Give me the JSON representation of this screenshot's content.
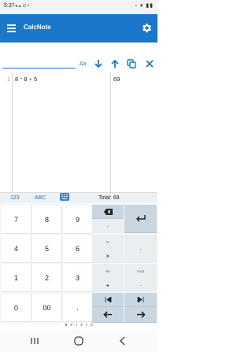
{
  "status_bar": {
    "time": "5:37"
  },
  "app": {
    "title": "CalcNote"
  },
  "find": {
    "placeholder": "",
    "value": "",
    "match_case_label": "Aa"
  },
  "editor": {
    "line_number": "1",
    "expression": {
      "a": "8",
      "op1": "*",
      "b": "8",
      "op2": "+",
      "c": "5"
    },
    "result": "69"
  },
  "keyboard": {
    "tabs": {
      "numeric": "123",
      "alpha": "ABC"
    },
    "total_label": "Total:",
    "total_value": "69",
    "digits": [
      "7",
      "8",
      "9",
      "4",
      "5",
      "6",
      "1",
      "2",
      "3",
      "0",
      "00",
      "."
    ],
    "ops": [
      {
        "main": "",
        "sub": "/"
      },
      {
        "main": "",
        "sub": "%"
      },
      {
        "main": "×",
        "sub": "÷"
      },
      {
        "main": "",
        "sub": "mod"
      },
      {
        "main": "",
        "sub": "sin"
      },
      {
        "main": "+",
        "sub": "−"
      },
      {
        "main": "",
        "sub": ""
      }
    ],
    "actions": [
      {
        "main": "",
        "sub": ""
      },
      {
        "main": "",
        "sub": ""
      },
      {
        "main": "",
        "sub": ""
      }
    ],
    "page_count": 6,
    "active_page": 1
  },
  "colors": {
    "primary": "#1b77c9",
    "accent": "#2e88d8",
    "key_action": "#c8d6e2"
  }
}
